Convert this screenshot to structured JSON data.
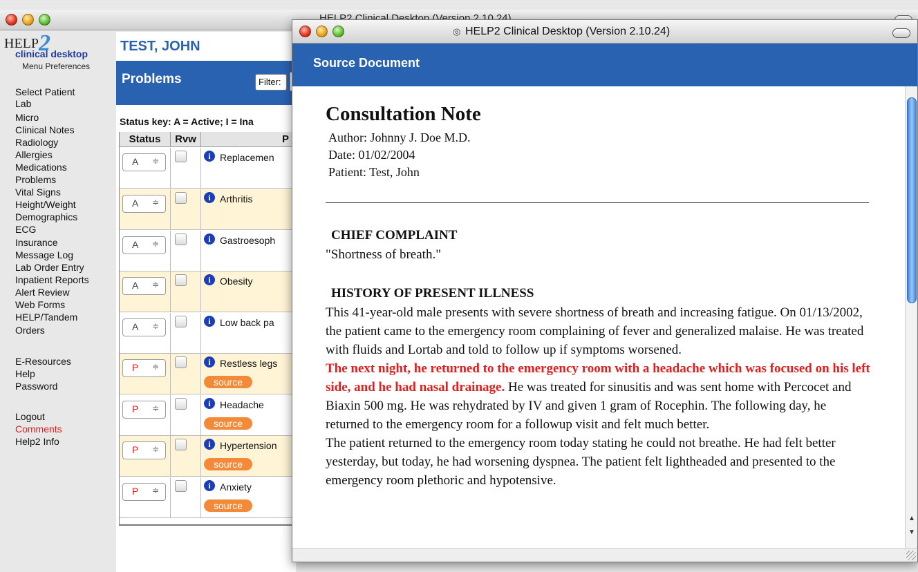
{
  "back_window": {
    "title": "HELP2 Clinical Desktop (Version 2.10.24)"
  },
  "logo": {
    "help": "HELP",
    "two": "2",
    "subtitle": "clinical desktop"
  },
  "menu_preferences": "Menu Preferences",
  "nav": {
    "items": [
      "Select Patient",
      "Lab",
      "Micro",
      "Clinical Notes",
      "Radiology",
      "Allergies",
      "Medications",
      "Problems",
      "Vital Signs",
      "Height/Weight",
      "Demographics",
      "ECG",
      "Insurance",
      "Message Log",
      "Lab Order Entry",
      "Inpatient Reports",
      "Alert Review",
      "Web Forms",
      "HELP/Tandem",
      "Orders"
    ],
    "secondary": [
      "E-Resources",
      "Help",
      "Password"
    ],
    "tertiary": [
      "Logout",
      "Comments",
      "Help2 Info"
    ]
  },
  "patient_name": "TEST, JOHN",
  "problems": {
    "title": "Problems",
    "filter_label": "Filter:",
    "status_key": "Status key: A = Active; I = Ina",
    "columns": [
      "Status",
      "Rvw",
      "P"
    ],
    "rows": [
      {
        "status": "A",
        "name": "Replacemen",
        "source": ""
      },
      {
        "status": "A",
        "name": "Arthritis",
        "source": ""
      },
      {
        "status": "A",
        "name": "Gastroesoph",
        "source": ""
      },
      {
        "status": "A",
        "name": "Obesity",
        "source": ""
      },
      {
        "status": "A",
        "name": "Low back pa",
        "source": ""
      },
      {
        "status": "P",
        "name": "Restless legs",
        "source": "source"
      },
      {
        "status": "P",
        "name": "Headache",
        "source": "source"
      },
      {
        "status": "P",
        "name": "Hypertension",
        "source": "source"
      },
      {
        "status": "P",
        "name": "Anxiety",
        "source": "source"
      }
    ]
  },
  "front_window": {
    "title": "HELP2 Clinical Desktop (Version 2.10.24)",
    "header": "Source Document"
  },
  "document": {
    "title": "Consultation Note",
    "author": "Author: Johnny J. Doe  M.D.",
    "date": "Date: 01/02/2004",
    "patient": "Patient: Test, John",
    "chief_complaint_heading": "CHIEF COMPLAINT",
    "chief_complaint": "\"Shortness of breath.\"",
    "hpi_heading": "HISTORY OF PRESENT ILLNESS",
    "hpi_p1": "This 41-year-old male presents with severe shortness of breath and increasing fatigue.  On 01/13/2002, the patient came to the emergency room complaining of fever and generalized malaise.  He was treated with fluids and Lortab and told to follow up if symptoms worsened.",
    "hpi_highlight": "The next night, he returned to the emergency room with a headache which was focused on his left side, and he had nasal drainage.",
    "hpi_p2": " He was treated for sinusitis and was sent home with Percocet and Biaxin 500 mg.  He was rehydrated by IV and given 1 gram of Rocephin.  The following day, he returned to the emergency room for a followup visit and felt much better.",
    "hpi_p3": " The patient returned to the emergency room today stating he could not breathe. He had felt better yesterday, but today, he had worsening dyspnea.  The patient felt lightheaded and presented to the emergency room plethoric and hypotensive."
  }
}
